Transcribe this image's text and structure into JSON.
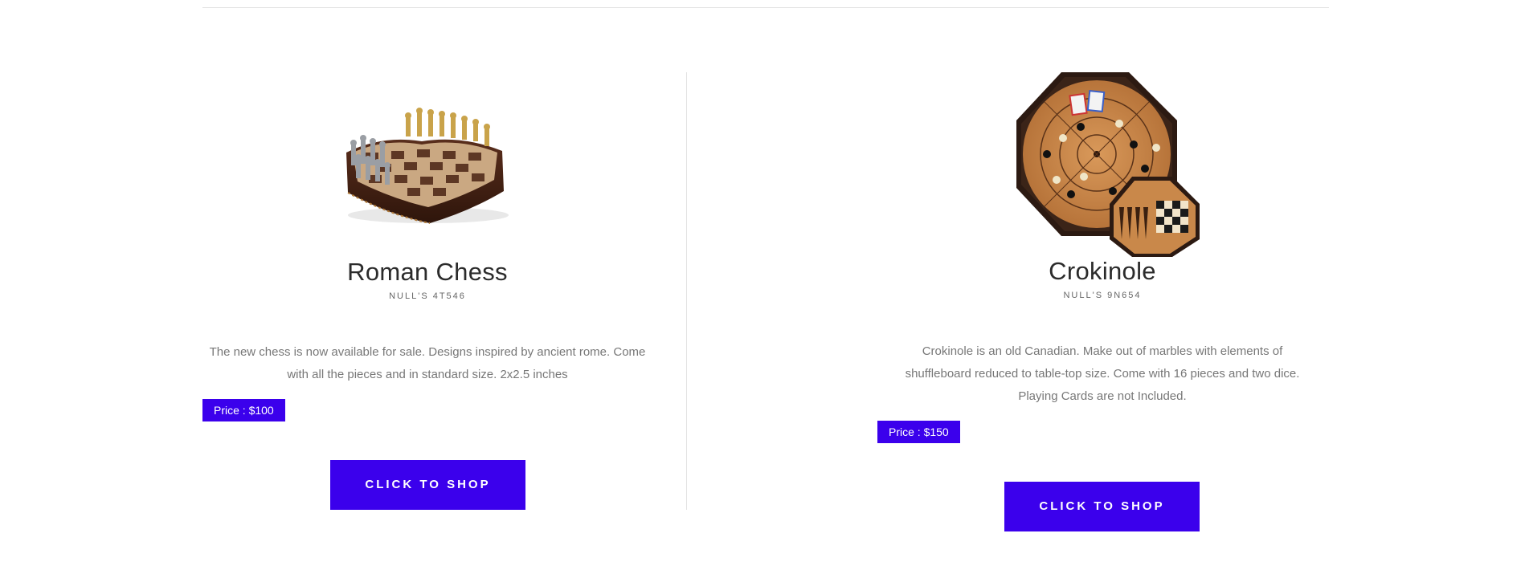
{
  "products": [
    {
      "title": "Roman Chess",
      "sku": "NULL'S 4T546",
      "description": "The new chess is now available for sale. Designs inspired by ancient rome. Come with all the pieces and in standard size. 2x2.5 inches",
      "price": "Price : $100",
      "button_label": "CLICK TO SHOP"
    },
    {
      "title": "Crokinole",
      "sku": "NULL'S 9N654",
      "description": "Crokinole is an old Canadian. Make out of marbles with elements of shuffleboard reduced to table-top size. Come with 16 pieces and two dice. Playing Cards are not Included.",
      "price": "Price : $150",
      "button_label": "CLICK TO SHOP"
    }
  ],
  "colors": {
    "accent": "#3b00ec",
    "divider": "#e3e3e3"
  }
}
